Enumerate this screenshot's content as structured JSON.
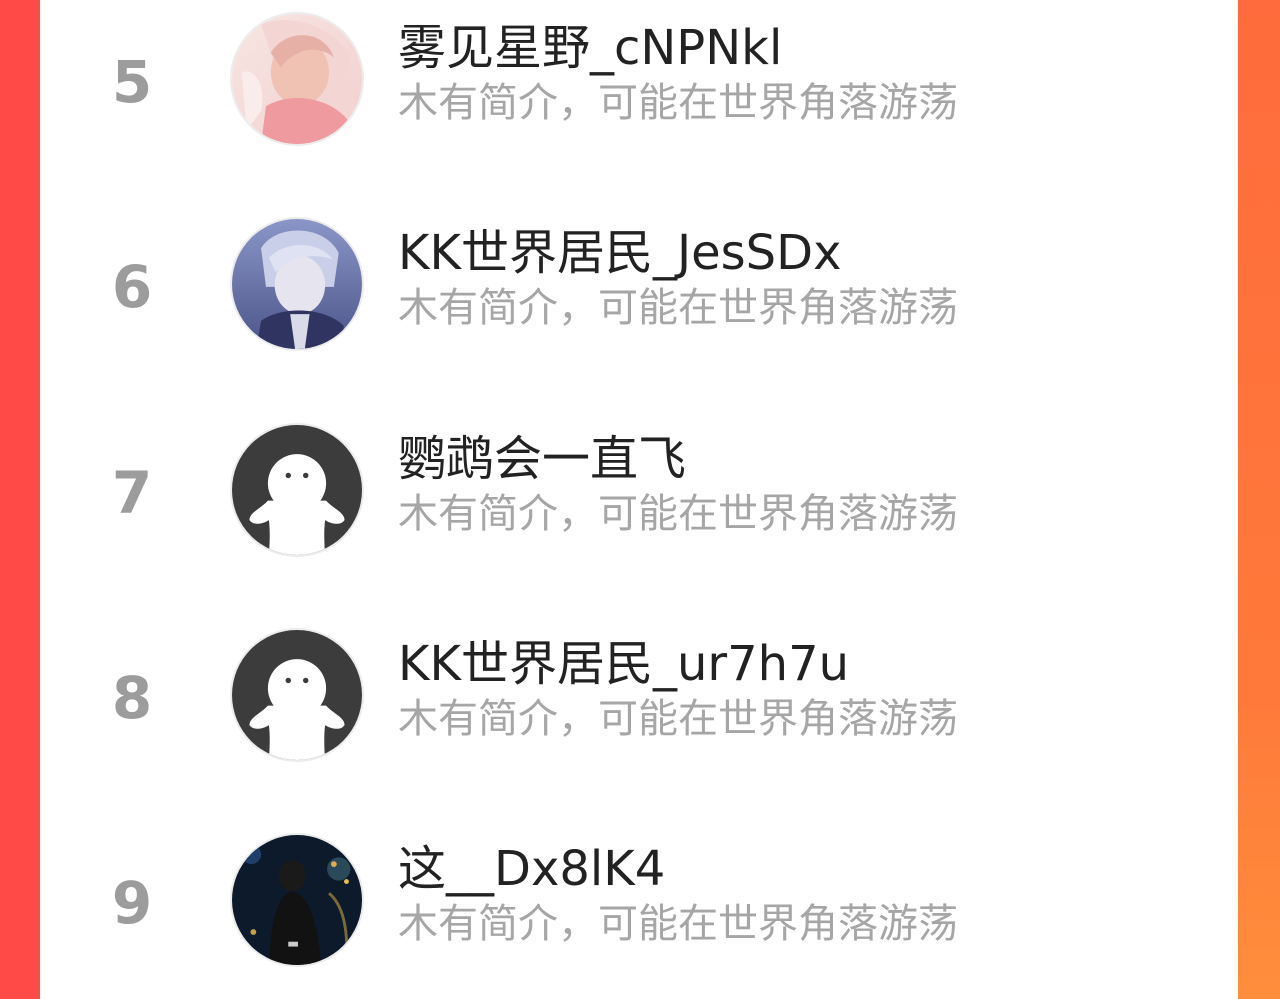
{
  "ranking_list": {
    "items": [
      {
        "rank": "5",
        "name": "雾见星野_cNPNkl",
        "bio": "木有简介，可能在世界角落游荡",
        "avatar": "anime-illustration-avatar"
      },
      {
        "rank": "6",
        "name": "KK世界居民_JesSDx",
        "bio": "木有简介，可能在世界角落游荡",
        "avatar": "anime-boy-avatar"
      },
      {
        "rank": "7",
        "name": "鹦鹉会一直飞",
        "bio": "木有简介，可能在世界角落游荡",
        "avatar": "default-ghost-avatar"
      },
      {
        "rank": "8",
        "name": "KK世界居民_ur7h7u",
        "bio": "木有简介，可能在世界角落游荡",
        "avatar": "default-ghost-avatar"
      },
      {
        "rank": "9",
        "name": "这__Dx8lK4",
        "bio": "木有简介，可能在世界角落游荡",
        "avatar": "night-photo-avatar"
      }
    ]
  },
  "colors": {
    "background_gradient_start": "#ff4a47",
    "background_gradient_end": "#ff7a3a",
    "rank_text": "#9c9c9c",
    "name_text": "#222222",
    "bio_text": "#a6a6a6",
    "default_avatar": "#3c3c3c"
  }
}
